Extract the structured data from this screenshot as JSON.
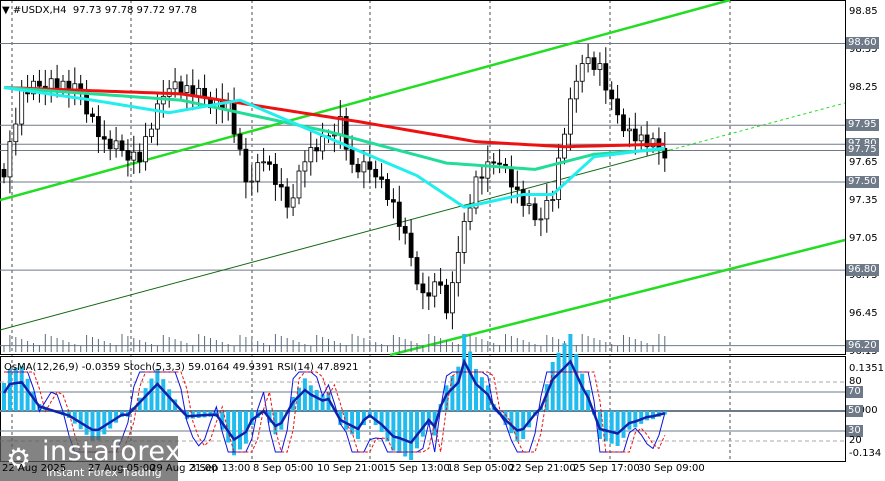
{
  "header": {
    "symbol": "#USDX,H4",
    "ohlc": "97.73 97.78 97.72 97.78"
  },
  "indicators": {
    "label": "OsMA(12,26,9) -0.0359  Stoch(5,3,3) 59.0164 49.9391  RSI(14) 47.8921"
  },
  "price_scale": [
    "98.85",
    "98.55",
    "98.25",
    "97.65",
    "97.35",
    "97.05",
    "96.75",
    "96.45",
    "96.15"
  ],
  "levels": [
    "98.60",
    "97.95",
    "97.80",
    "97.75",
    "97.50",
    "96.80",
    "96.20"
  ],
  "osc_scale": {
    "top": "0.1351",
    "l80": "80",
    "l70": "70",
    "l50": "50",
    "l0": "0.000",
    "l30": "30",
    "l20": "20",
    "bottom": "-0.134"
  },
  "dates": [
    "22 Aug 2025",
    "27 Aug 05:00",
    "29 Aug 21:00",
    "3 Sep 13:00",
    "8 Sep 05:00",
    "10 Sep 21:00",
    "15 Sep 13:00",
    "18 Sep 05:00",
    "22 Sep 21:00",
    "25 Sep 17:00",
    "30 Sep 09:00"
  ],
  "logo": {
    "name": "instaforex",
    "tagline": "Instant Forex Trading"
  },
  "chart_data": {
    "type": "candlestick",
    "title": "#USDX,H4",
    "ylim": [
      96.15,
      98.85
    ],
    "closes_keypoints": [
      [
        0,
        97.6
      ],
      [
        3,
        98.2
      ],
      [
        8,
        98.3
      ],
      [
        13,
        98.2
      ],
      [
        17,
        97.8
      ],
      [
        23,
        97.7
      ],
      [
        28,
        98.3
      ],
      [
        32,
        98.2
      ],
      [
        38,
        98.1
      ],
      [
        41,
        97.5
      ],
      [
        44,
        97.7
      ],
      [
        48,
        97.3
      ],
      [
        51,
        97.7
      ],
      [
        54,
        97.8
      ],
      [
        57,
        98.0
      ],
      [
        59,
        97.6
      ],
      [
        63,
        97.6
      ],
      [
        66,
        97.3
      ],
      [
        69,
        96.9
      ],
      [
        71,
        96.6
      ],
      [
        74,
        96.7
      ],
      [
        75,
        96.4
      ],
      [
        77,
        97.0
      ],
      [
        80,
        97.5
      ],
      [
        84,
        97.7
      ],
      [
        87,
        97.4
      ],
      [
        90,
        97.2
      ],
      [
        93,
        97.4
      ],
      [
        95,
        97.9
      ],
      [
        98,
        98.5
      ],
      [
        101,
        98.4
      ],
      [
        103,
        98.1
      ],
      [
        106,
        97.9
      ],
      [
        109,
        97.8
      ],
      [
        112,
        97.75
      ]
    ],
    "ma_red_keypoints": [
      [
        0,
        98.25
      ],
      [
        30,
        98.2
      ],
      [
        60,
        97.98
      ],
      [
        80,
        97.82
      ],
      [
        95,
        97.78
      ],
      [
        112,
        97.8
      ]
    ],
    "ma_teal_keypoints": [
      [
        0,
        98.25
      ],
      [
        30,
        98.15
      ],
      [
        55,
        97.9
      ],
      [
        75,
        97.65
      ],
      [
        90,
        97.6
      ],
      [
        100,
        97.72
      ],
      [
        112,
        97.76
      ]
    ],
    "ma_cyan_keypoints": [
      [
        0,
        98.25
      ],
      [
        15,
        98.15
      ],
      [
        28,
        98.05
      ],
      [
        40,
        98.15
      ],
      [
        55,
        97.85
      ],
      [
        70,
        97.55
      ],
      [
        78,
        97.3
      ],
      [
        88,
        97.4
      ],
      [
        93,
        97.4
      ],
      [
        100,
        97.7
      ],
      [
        112,
        97.77
      ]
    ]
  }
}
